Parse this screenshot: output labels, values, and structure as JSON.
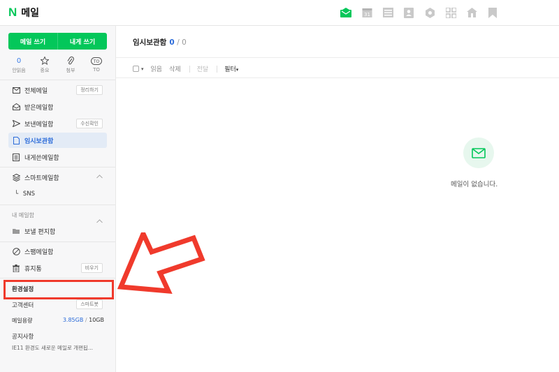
{
  "header": {
    "brand_letter": "N",
    "app_title": "메일",
    "apps": [
      {
        "name": "mail-app-icon",
        "color": "#03c75a"
      },
      {
        "name": "calendar-app-icon",
        "label": "31"
      },
      {
        "name": "list-app-icon"
      },
      {
        "name": "contacts-app-icon"
      },
      {
        "name": "cloud-app-icon"
      },
      {
        "name": "grid-app-icon"
      },
      {
        "name": "home-app-icon"
      },
      {
        "name": "bookmark-app-icon"
      }
    ]
  },
  "sidebar": {
    "compose_label": "메일 쓰기",
    "self_compose_label": "내게 쓰기",
    "quick": [
      {
        "top": "0",
        "label": "안읽음"
      },
      {
        "top": "☆",
        "label": "중요"
      },
      {
        "top": "📎",
        "label": "첨부"
      },
      {
        "top": "TO",
        "label": "TO"
      }
    ],
    "folders": [
      {
        "label": "전체메일",
        "badge": "정리하기",
        "icon": "mail-icon"
      },
      {
        "label": "받은메일함",
        "icon": "inbox-icon"
      },
      {
        "label": "보낸메일함",
        "badge": "수신확인",
        "icon": "send-icon"
      },
      {
        "label": "임시보관함",
        "icon": "draft-icon",
        "active": true
      },
      {
        "label": "내게쓴메일함",
        "icon": "self-memo-icon"
      }
    ],
    "smart": {
      "label": "스마트메일함",
      "sub": "SNS"
    },
    "my_mailbox": {
      "label": "내 메일함",
      "sub": "보낼 편지함"
    },
    "spam_label": "스팸메일함",
    "trash_label": "휴지통",
    "trash_badge": "비우기",
    "settings_label": "환경설정",
    "support_label": "고객센터",
    "support_badge": "스마트봇",
    "storage_label": "메일용량",
    "storage_used": "3.85GB",
    "storage_sep": "/",
    "storage_total": "10GB",
    "notice_label": "공지사항",
    "notice_text": "IE11 환경도 새로운 메일로 개편됩..."
  },
  "main": {
    "title": "임시보관함",
    "count": "0",
    "total": "/ 0",
    "toolbar": {
      "read": "읽음",
      "delete": "삭제",
      "forward": "전달",
      "filter": "필터"
    },
    "empty_text": "메일이 없습니다."
  },
  "colors": {
    "brand": "#03c75a",
    "active_text": "#2b6bd9",
    "highlight": "#f03a2c"
  }
}
